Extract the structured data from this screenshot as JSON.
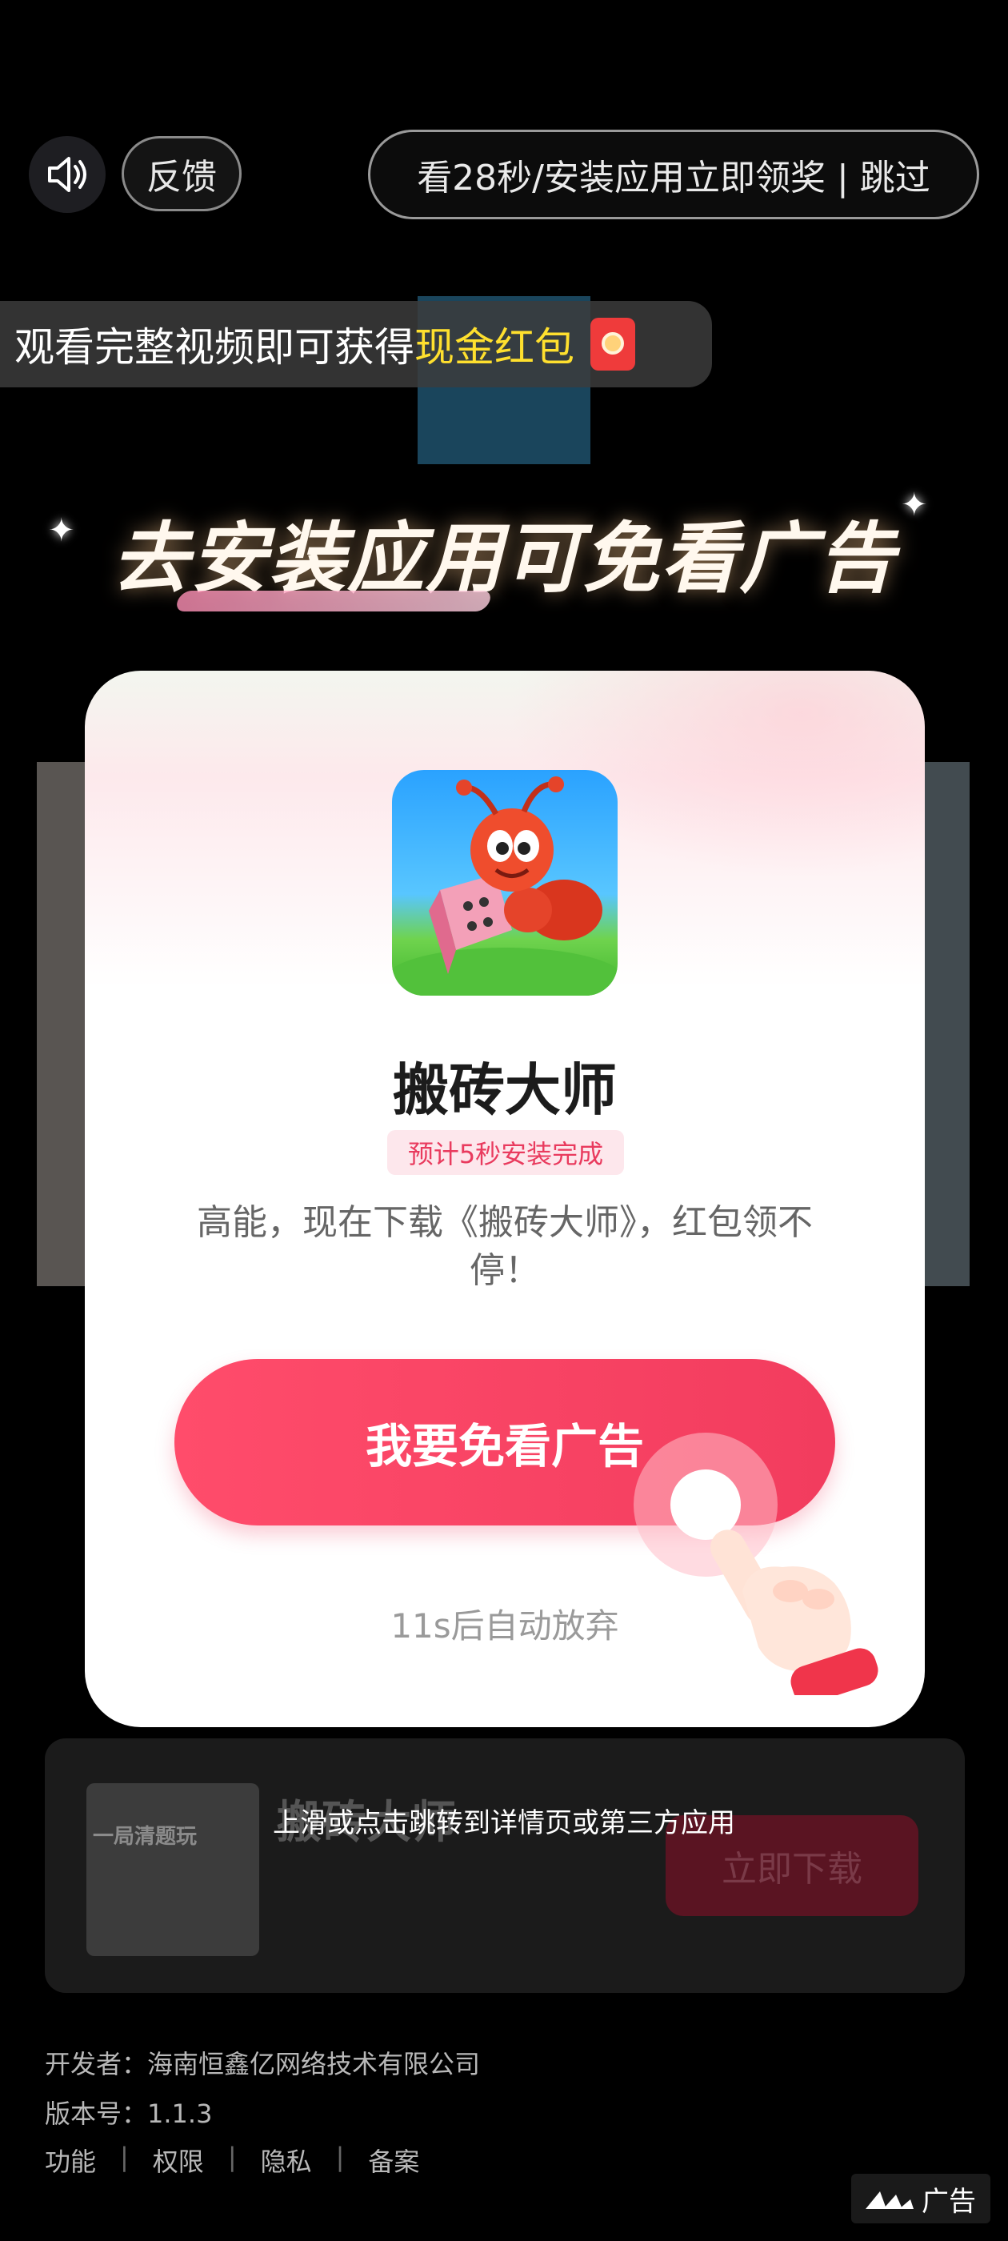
{
  "topbar": {
    "feedback_label": "反馈",
    "skip_text": "看28秒/安装应用立即领奖 | 跳过"
  },
  "reward_bar": {
    "prefix": "观看完整视频即可获得",
    "highlight": "现金红包"
  },
  "headline": {
    "part1": "去",
    "part2": "安装应用",
    "part3": "可免看广告"
  },
  "modal": {
    "app_name": "搬砖大师",
    "install_tag": "预计5秒安装完成",
    "description": "高能，现在下载《搬砖大师》，红包领不停！",
    "cta_label": "我要免看广告",
    "auto_text": "11s后自动放弃"
  },
  "bottom_card": {
    "thumb_text": "一局清题玩",
    "title": "搬砖大师",
    "download_label": "立即下载",
    "swipe_hint": "上滑或点击跳转到详情页或第三方应用"
  },
  "info": {
    "developer": "开发者：海南恒鑫亿网络技术有限公司",
    "version": "版本号：1.1.3",
    "links": [
      "功能",
      "权限",
      "隐私",
      "备案"
    ]
  },
  "ad_badge": "广告",
  "colors": {
    "accent": "#f23c5e",
    "highlight_yellow": "#ffe02e",
    "tag_bg": "#fde7ec"
  }
}
